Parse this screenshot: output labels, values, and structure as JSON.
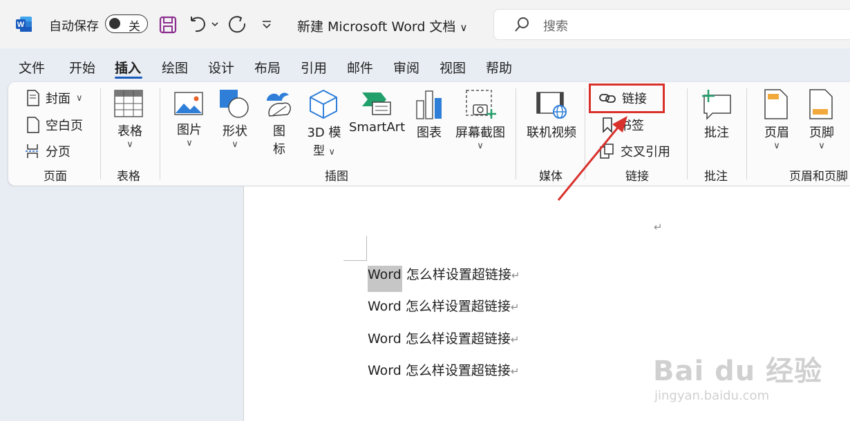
{
  "titlebar": {
    "app_icon": "word-icon",
    "autosave_label": "自动保存",
    "autosave_toggle": "关",
    "doc_title": "新建 Microsoft Word 文档",
    "search_placeholder": "搜索"
  },
  "tabs": [
    "文件",
    "开始",
    "插入",
    "绘图",
    "设计",
    "布局",
    "引用",
    "邮件",
    "审阅",
    "视图",
    "帮助"
  ],
  "active_tab": "插入",
  "ribbon": {
    "pages": {
      "cover": "封面",
      "blank": "空白页",
      "break": "分页",
      "group": "页面"
    },
    "table": {
      "label": "表格",
      "group": "表格"
    },
    "illustrations": {
      "pictures": "图片",
      "shapes": "形状",
      "icons_1": "图",
      "icons_2": "标",
      "models_1": "3D 模",
      "models_2": "型",
      "smartart": "SmartArt",
      "chart": "图表",
      "screenshot": "屏幕截图",
      "group": "插图"
    },
    "media": {
      "video": "联机视频",
      "group": "媒体"
    },
    "links": {
      "link": "链接",
      "bookmark": "书签",
      "crossref": "交叉引用",
      "group": "链接"
    },
    "comments": {
      "comment": "批注",
      "group": "批注"
    },
    "header_footer": {
      "header": "页眉",
      "footer": "页脚",
      "group": "页眉和页脚"
    }
  },
  "document": {
    "lines": [
      {
        "word": "Word",
        "rest": " 怎么样设置超链接"
      },
      {
        "word": "Word",
        "rest": " 怎么样设置超链接"
      },
      {
        "word": "Word",
        "rest": " 怎么样设置超链接"
      },
      {
        "word": "Word",
        "rest": " 怎么样设置超链接"
      }
    ],
    "return_mark": "↵"
  },
  "watermark": {
    "brand": "Bai du 经验",
    "url": "jingyan.baidu.com"
  },
  "colors": {
    "accent": "#185abd",
    "highlight": "#d9312c",
    "selection": "#c6c6c6"
  }
}
